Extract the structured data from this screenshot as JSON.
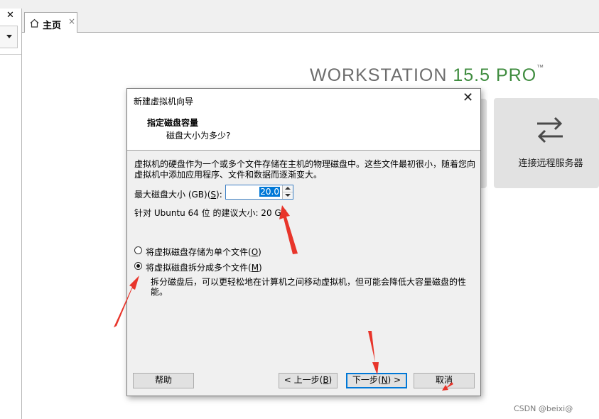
{
  "left_panel": {
    "close_glyph": "✕"
  },
  "tab": {
    "label": "主页",
    "close_glyph": "×"
  },
  "brand": {
    "name": "WORKSTATION",
    "version": "15.5",
    "edition": "PRO",
    "tm": "™"
  },
  "cards": {
    "remote_server": "连接远程服务器"
  },
  "dialog": {
    "title": "新建虚拟机向导",
    "close_glyph": "✕",
    "header_title": "指定磁盘容量",
    "header_subtitle": "磁盘大小为多少?",
    "description": "虚拟机的硬盘作为一个或多个文件存储在主机的物理磁盘中。这些文件最初很小，随着您向虚拟机中添加应用程序、文件和数据而逐渐变大。",
    "max_size_label_pre": "最大磁盘大小 (GB)(",
    "max_size_label_key": "S",
    "max_size_label_post": "):",
    "max_size_value": "20.0",
    "recommendation": "针对 Ubuntu 64 位 的建议大小: 20 GB",
    "radio_single_pre": "将虚拟磁盘存储为单个文件(",
    "radio_single_key": "O",
    "radio_single_post": ")",
    "radio_multi_pre": "将虚拟磁盘拆分成多个文件(",
    "radio_multi_key": "M",
    "radio_multi_post": ")",
    "selected_option": "multi",
    "split_note": "拆分磁盘后，可以更轻松地在计算机之间移动虚拟机，但可能会降低大容量磁盘的性能。",
    "buttons": {
      "help": "帮助",
      "back_pre": "< 上一步(",
      "back_key": "B",
      "back_post": ")",
      "next_pre": "下一步(",
      "next_key": "N",
      "next_post": ") >",
      "cancel": "取消"
    }
  },
  "watermark": "CSDN @beixi@",
  "colors": {
    "annotation_red": "#e8352b",
    "brand_green": "#3f8c3f",
    "focus_blue": "#0078d7"
  },
  "icons": [
    "home-icon",
    "close-icon",
    "chevron-down-icon",
    "swap-arrows-icon",
    "spin-up-icon",
    "spin-down-icon"
  ]
}
